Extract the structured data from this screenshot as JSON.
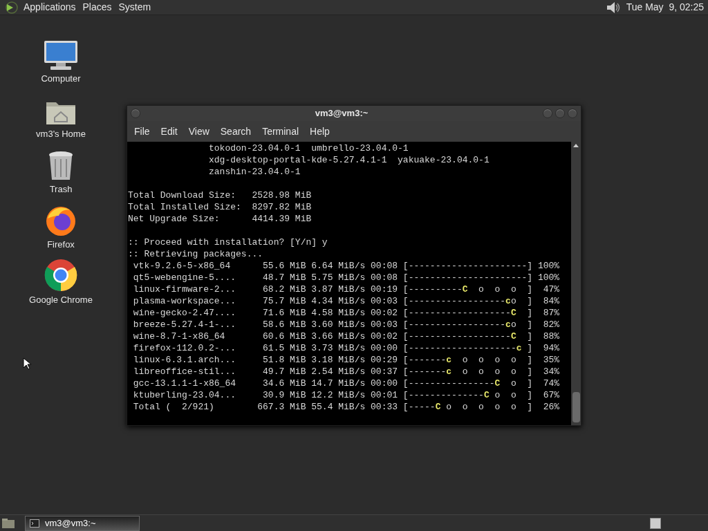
{
  "top_panel": {
    "menus": [
      "Applications",
      "Places",
      "System"
    ],
    "clock": "Tue May  9, 02:25"
  },
  "desktop_icons": [
    {
      "label": "Computer",
      "kind": "computer"
    },
    {
      "label": "vm3's Home",
      "kind": "home"
    },
    {
      "label": "Trash",
      "kind": "trash"
    },
    {
      "label": "Firefox",
      "kind": "firefox"
    },
    {
      "label": "Google Chrome",
      "kind": "chrome"
    }
  ],
  "window": {
    "title": "vm3@vm3:~",
    "menu": [
      "File",
      "Edit",
      "View",
      "Search",
      "Terminal",
      "Help"
    ],
    "terminal_lines": [
      {
        "kind": "text",
        "text": "               tokodon-23.04.0-1  umbrello-23.04.0-1"
      },
      {
        "kind": "text",
        "text": "               xdg-desktop-portal-kde-5.27.4.1-1  yakuake-23.04.0-1"
      },
      {
        "kind": "text",
        "text": "               zanshin-23.04.0-1"
      },
      {
        "kind": "blank"
      },
      {
        "kind": "text",
        "text": "Total Download Size:   2528.98 MiB"
      },
      {
        "kind": "text",
        "text": "Total Installed Size:  8297.82 MiB"
      },
      {
        "kind": "text",
        "text": "Net Upgrade Size:      4414.39 MiB"
      },
      {
        "kind": "blank"
      },
      {
        "kind": "text",
        "text": ":: Proceed with installation? [Y/n] y"
      },
      {
        "kind": "text",
        "text": ":: Retrieving packages..."
      },
      {
        "kind": "progress",
        "name": "vtk-9.2.6-5-x86_64",
        "size": "55.6 MiB",
        "rate": "6.64 MiB/s",
        "time": "00:08",
        "before": "[----------------------]",
        "percent": "100%"
      },
      {
        "kind": "progress",
        "name": "qt5-webengine-5....",
        "size": "48.7 MiB",
        "rate": "5.75 MiB/s",
        "time": "00:08",
        "before": "[----------------------]",
        "percent": "100%"
      },
      {
        "kind": "progress",
        "name": "linux-firmware-2...",
        "size": "68.2 MiB",
        "rate": "3.87 MiB/s",
        "time": "00:19",
        "before": "[----------",
        "pac": "C",
        "after": "  o  o  o  ]",
        "percent": "47%"
      },
      {
        "kind": "progress",
        "name": "plasma-workspace...",
        "size": "75.7 MiB",
        "rate": "4.34 MiB/s",
        "time": "00:03",
        "before": "[------------------",
        "pac": "c",
        "after": "o  ]",
        "percent": "84%"
      },
      {
        "kind": "progress",
        "name": "wine-gecko-2.47....",
        "size": "71.6 MiB",
        "rate": "4.58 MiB/s",
        "time": "00:02",
        "before": "[-------------------",
        "pac": "C",
        "after": "  ]",
        "percent": "87%"
      },
      {
        "kind": "progress",
        "name": "breeze-5.27.4-1-...",
        "size": "58.6 MiB",
        "rate": "3.60 MiB/s",
        "time": "00:03",
        "before": "[------------------",
        "pac": "c",
        "after": "o  ]",
        "percent": "82%"
      },
      {
        "kind": "progress",
        "name": "wine-8.7-1-x86_64",
        "size": "60.6 MiB",
        "rate": "3.66 MiB/s",
        "time": "00:02",
        "before": "[-------------------",
        "pac": "C",
        "after": "  ]",
        "percent": "88%"
      },
      {
        "kind": "progress",
        "name": "firefox-112.0.2-...",
        "size": "61.5 MiB",
        "rate": "3.73 MiB/s",
        "time": "00:00",
        "before": "[--------------------",
        "pac": "c",
        "after": " ]",
        "percent": "94%"
      },
      {
        "kind": "progress",
        "name": "linux-6.3.1.arch...",
        "size": "51.8 MiB",
        "rate": "3.18 MiB/s",
        "time": "00:29",
        "before": "[-------",
        "pac": "c",
        "after": "  o  o  o  o  ]",
        "percent": "35%"
      },
      {
        "kind": "progress",
        "name": "libreoffice-stil...",
        "size": "49.7 MiB",
        "rate": "2.54 MiB/s",
        "time": "00:37",
        "before": "[-------",
        "pac": "c",
        "after": "  o  o  o  o  ]",
        "percent": "34%"
      },
      {
        "kind": "progress",
        "name": "gcc-13.1.1-1-x86_64",
        "size": "34.6 MiB",
        "rate": "14.7 MiB/s",
        "time": "00:00",
        "before": "[----------------",
        "pac": "C",
        "after": "  o  ]",
        "percent": "74%"
      },
      {
        "kind": "progress",
        "name": "ktuberling-23.04...",
        "size": "30.9 MiB",
        "rate": "12.2 MiB/s",
        "time": "00:01",
        "before": "[--------------",
        "pac": "C",
        "after": " o  o  ]",
        "percent": "67%"
      },
      {
        "kind": "progress",
        "name": "Total (  2/921)",
        "size": "667.3 MiB",
        "rate": "55.4 MiB/s",
        "time": "00:33",
        "before": "[-----",
        "pac": "C",
        "after": " o  o  o  o  o  ]",
        "percent": "26%"
      }
    ]
  },
  "taskbar": {
    "tasks": [
      {
        "label": "vm3@vm3:~",
        "selected": true
      }
    ]
  }
}
